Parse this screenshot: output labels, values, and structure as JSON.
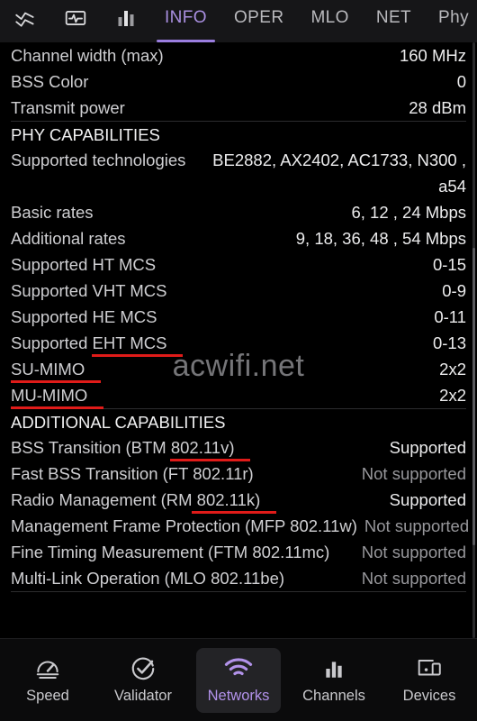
{
  "topbar": {
    "icons": [
      {
        "name": "line-chart-icon"
      },
      {
        "name": "monitor-pulse-icon"
      },
      {
        "name": "bar-chart-icon"
      }
    ],
    "tabs": [
      {
        "label": "INFO",
        "active": true
      },
      {
        "label": "OPER",
        "active": false
      },
      {
        "label": "MLO",
        "active": false
      },
      {
        "label": "NET",
        "active": false
      },
      {
        "label": "Phy",
        "active": false
      }
    ],
    "accent_color": "#a98fe0",
    "underline_color": "#9b7ee0"
  },
  "watermark": {
    "text": "acwifi.net"
  },
  "content": {
    "top_rows": [
      {
        "key": "Channel width (max)",
        "value": "160 MHz"
      },
      {
        "key": "BSS Color",
        "value": "0"
      },
      {
        "key": "Transmit power",
        "value": "28 dBm"
      }
    ],
    "phy_section": {
      "title": "PHY CAPABILITIES",
      "rows": [
        {
          "key": "Supported technologies",
          "value": "BE2882, AX2402, AC1733, N300 , a54",
          "tall": true
        },
        {
          "key": "Basic rates",
          "value": "6, 12 , 24 Mbps"
        },
        {
          "key": "Additional rates",
          "value": "9, 18, 36, 48 , 54 Mbps"
        },
        {
          "key": "Supported HT MCS",
          "value": "0-15"
        },
        {
          "key": "Supported VHT MCS",
          "value": "0-9"
        },
        {
          "key": "Supported HE MCS",
          "value": "0-11"
        },
        {
          "key": "Supported EHT MCS",
          "value": "0-13",
          "marked": true
        },
        {
          "key": "SU-MIMO",
          "value": "2x2",
          "marked": true
        },
        {
          "key": "MU-MIMO",
          "value": "2x2",
          "marked": true
        }
      ]
    },
    "additional_section": {
      "title": "ADDITIONAL CAPABILITIES",
      "rows": [
        {
          "key": "BSS Transition (BTM 802.11v)",
          "value": "Supported",
          "marked": true
        },
        {
          "key": "Fast BSS Transition (FT 802.11r)",
          "value": "Not supported",
          "dim": true
        },
        {
          "key": "Radio Management (RM 802.11k)",
          "value": "Supported",
          "marked": true
        },
        {
          "key": "Management Frame Protection (MFP 802.11w)",
          "value": "Not supported",
          "dim": true
        },
        {
          "key": "Fine Timing Measurement (FTM 802.11mc)",
          "value": "Not supported",
          "dim": true
        },
        {
          "key": "Multi-Link Operation (MLO 802.11be)",
          "value": "Not supported",
          "dim": true
        }
      ]
    },
    "marker_color": "#e01b19"
  },
  "bottomnav": {
    "items": [
      {
        "label": "Speed",
        "icon": "speedometer-icon",
        "active": false
      },
      {
        "label": "Validator",
        "icon": "check-circle-icon",
        "active": false
      },
      {
        "label": "Networks",
        "icon": "wifi-icon",
        "active": true
      },
      {
        "label": "Channels",
        "icon": "bar-chart-icon",
        "active": false
      },
      {
        "label": "Devices",
        "icon": "devices-icon",
        "active": false
      }
    ],
    "active_color": "#b292ea"
  }
}
